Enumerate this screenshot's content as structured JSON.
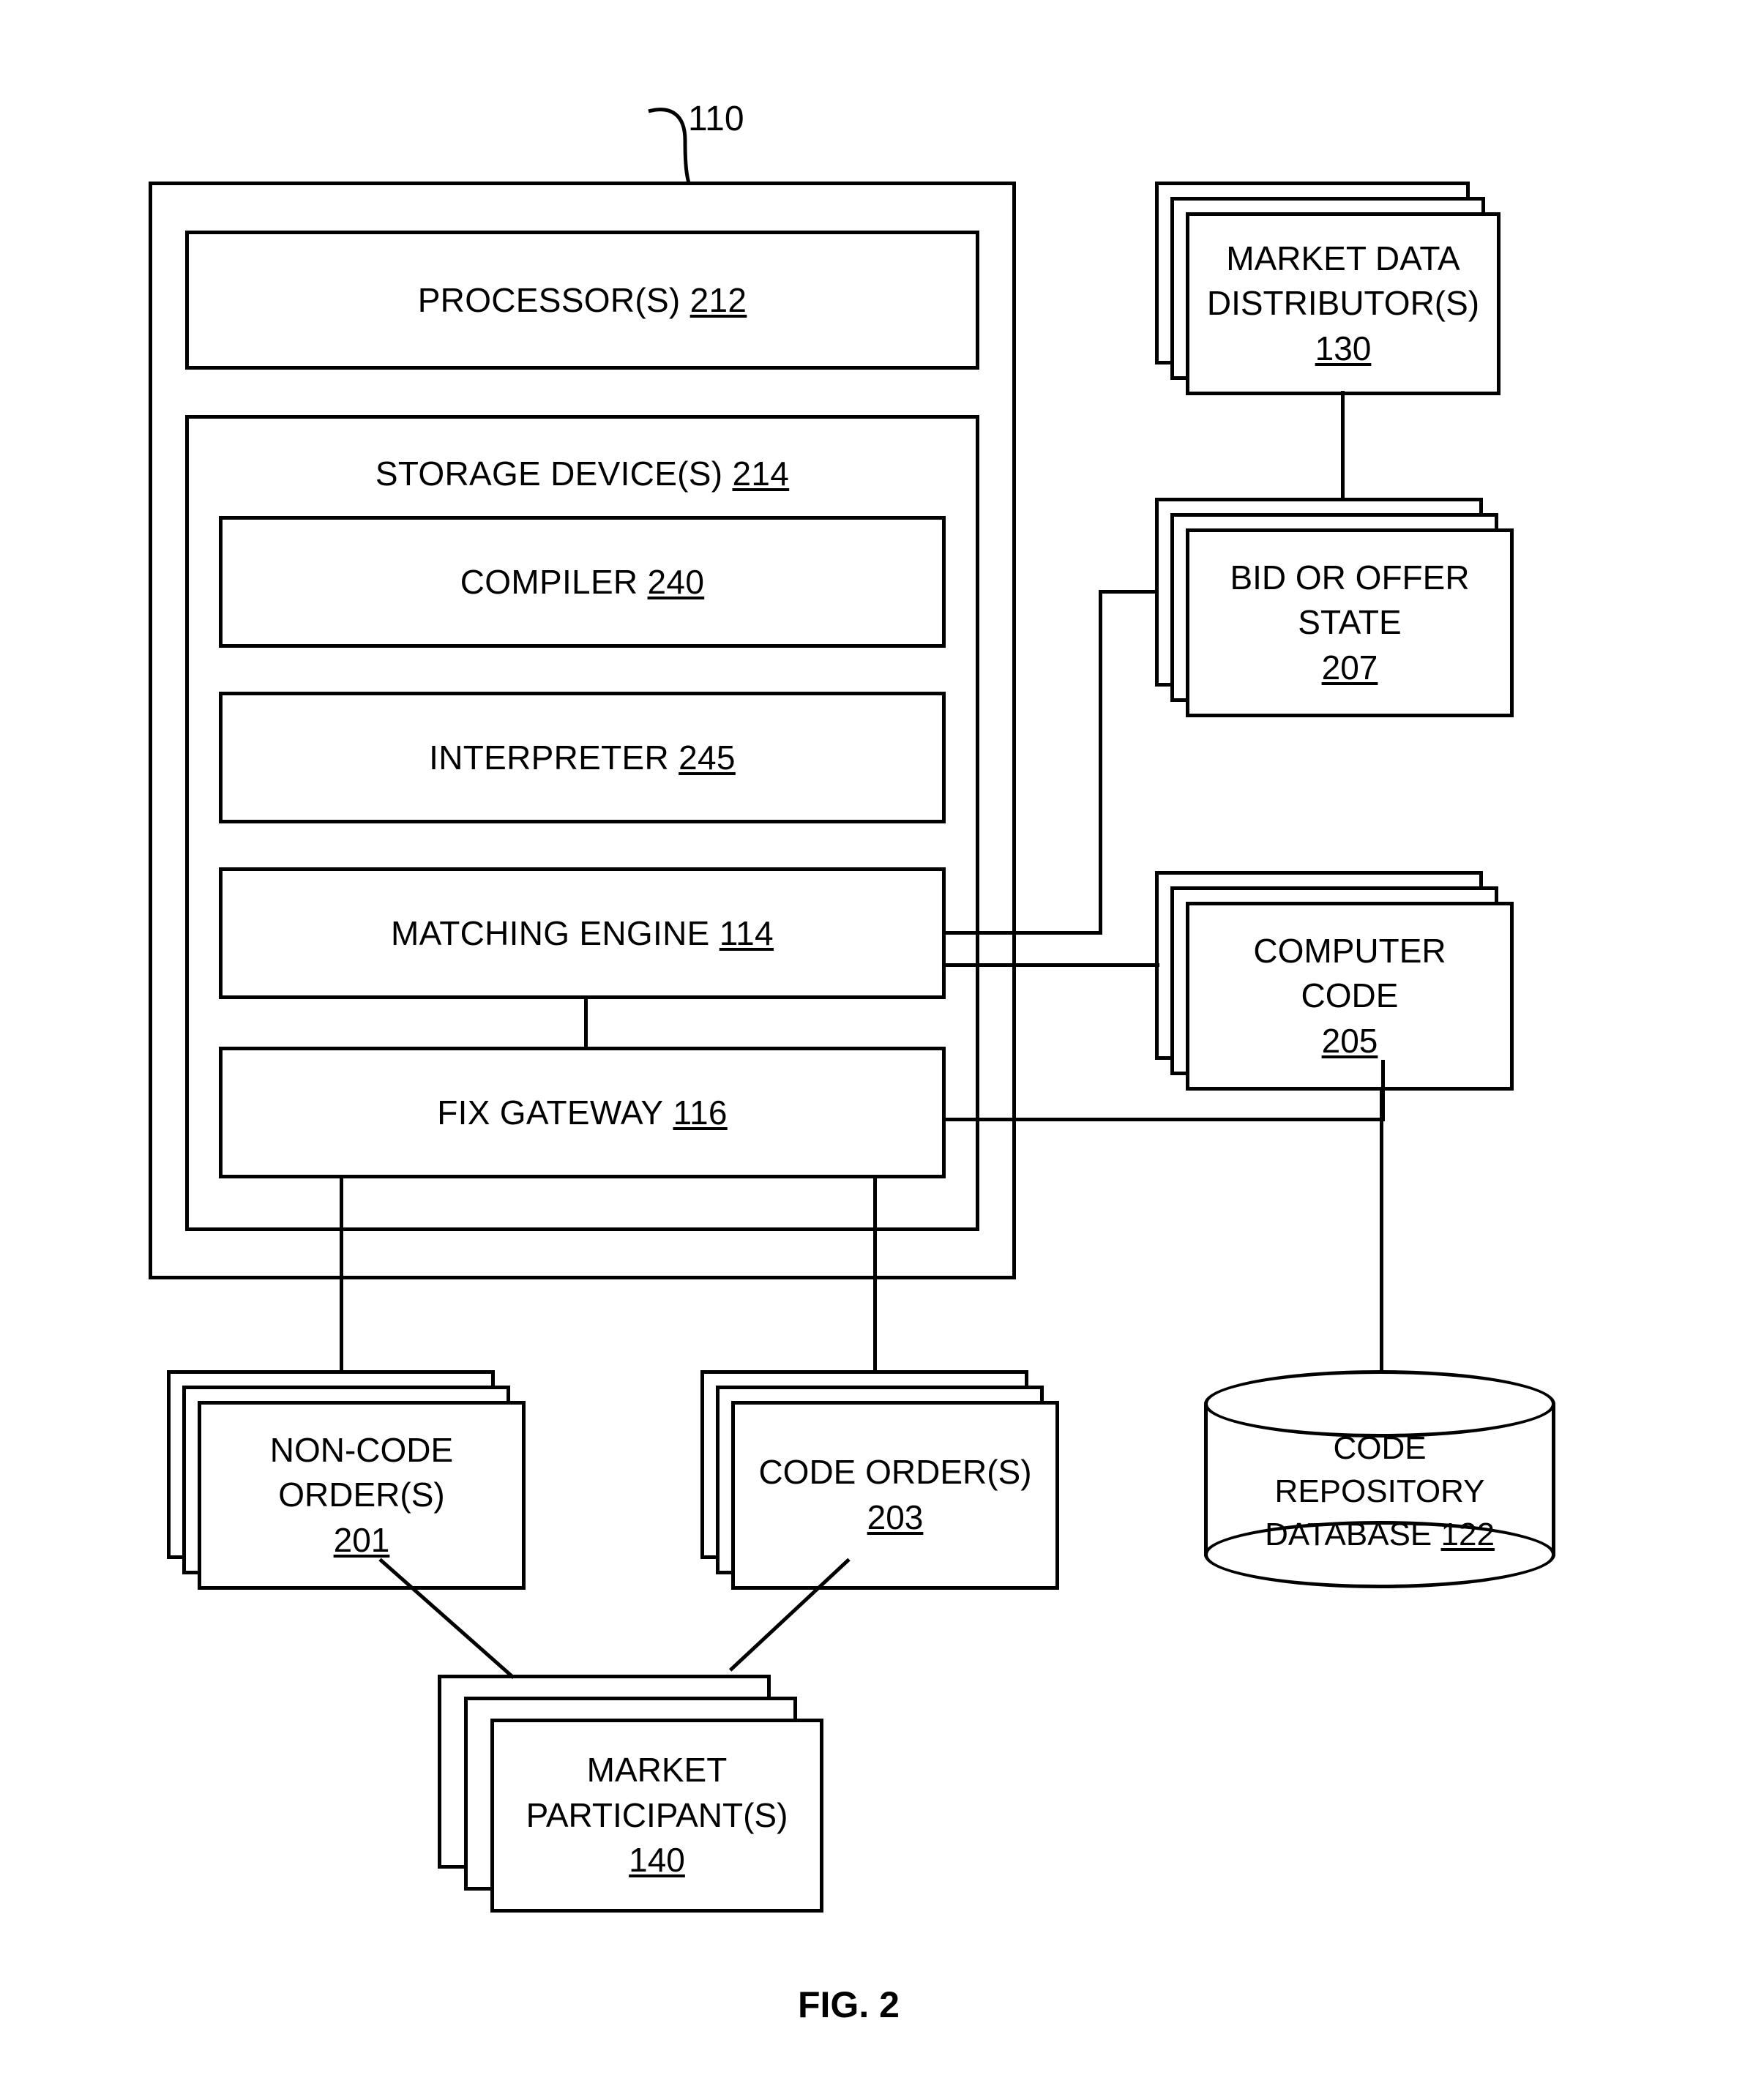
{
  "figure": {
    "caption": "FIG. 2",
    "lead_label": "110"
  },
  "system": {
    "processor": {
      "label": "PROCESSOR(S)",
      "ref": "212"
    },
    "storage": {
      "label": "STORAGE DEVICE(S)",
      "ref": "214"
    },
    "compiler": {
      "label": "COMPILER",
      "ref": "240"
    },
    "interpreter": {
      "label": "INTERPRETER",
      "ref": "245"
    },
    "matching_engine": {
      "label": "MATCHING ENGINE",
      "ref": "114"
    },
    "fix_gateway": {
      "label": "FIX GATEWAY",
      "ref": "116"
    }
  },
  "external": {
    "market_data_distributor": {
      "line1": "MARKET DATA",
      "line2": "DISTRIBUTOR(S)",
      "ref": "130"
    },
    "bid_or_offer_state": {
      "line1": "BID OR OFFER",
      "line2": "STATE",
      "ref": "207"
    },
    "computer_code": {
      "line1": "COMPUTER",
      "line2": "CODE",
      "ref": "205"
    },
    "code_repository_database": {
      "line1": "CODE",
      "line2": "REPOSITORY",
      "line3": "DATABASE",
      "ref": "122"
    },
    "non_code_orders": {
      "line1": "NON-CODE",
      "line2": "ORDER(S)",
      "ref": "201"
    },
    "code_orders": {
      "line1": "CODE ORDER(S)",
      "ref": "203"
    },
    "market_participants": {
      "line1": "MARKET",
      "line2": "PARTICIPANT(S)",
      "ref": "140"
    }
  },
  "style": {
    "stroke": "#000000",
    "background": "#ffffff"
  },
  "diagram_data": {
    "type": "block-diagram",
    "nodes": [
      {
        "id": "110",
        "name": "system container",
        "shape": "rectangle"
      },
      {
        "id": "212",
        "name": "PROCESSOR(S)",
        "shape": "rectangle"
      },
      {
        "id": "214",
        "name": "STORAGE DEVICE(S)",
        "shape": "rectangle"
      },
      {
        "id": "240",
        "name": "COMPILER",
        "shape": "rectangle"
      },
      {
        "id": "245",
        "name": "INTERPRETER",
        "shape": "rectangle"
      },
      {
        "id": "114",
        "name": "MATCHING ENGINE",
        "shape": "rectangle"
      },
      {
        "id": "116",
        "name": "FIX GATEWAY",
        "shape": "rectangle"
      },
      {
        "id": "130",
        "name": "MARKET DATA DISTRIBUTOR(S)",
        "shape": "stacked-rectangle"
      },
      {
        "id": "207",
        "name": "BID OR OFFER STATE",
        "shape": "stacked-rectangle"
      },
      {
        "id": "205",
        "name": "COMPUTER CODE",
        "shape": "stacked-rectangle"
      },
      {
        "id": "122",
        "name": "CODE REPOSITORY DATABASE",
        "shape": "cylinder"
      },
      {
        "id": "201",
        "name": "NON-CODE ORDER(S)",
        "shape": "stacked-rectangle"
      },
      {
        "id": "203",
        "name": "CODE ORDER(S)",
        "shape": "stacked-rectangle"
      },
      {
        "id": "140",
        "name": "MARKET PARTICIPANT(S)",
        "shape": "stacked-rectangle"
      }
    ],
    "edges": [
      {
        "from": "130",
        "to": "207"
      },
      {
        "from": "114",
        "to": "207"
      },
      {
        "from": "114",
        "to": "205"
      },
      {
        "from": "114",
        "to": "116"
      },
      {
        "from": "116",
        "to": "205"
      },
      {
        "from": "205",
        "to": "122"
      },
      {
        "from": "116",
        "to": "201"
      },
      {
        "from": "116",
        "to": "203"
      },
      {
        "from": "201",
        "to": "140"
      },
      {
        "from": "203",
        "to": "140"
      }
    ]
  }
}
